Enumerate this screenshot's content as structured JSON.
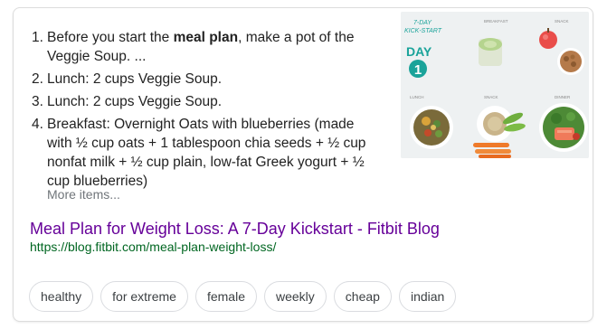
{
  "steps": [
    {
      "num": "1.",
      "pre": "Before you start the ",
      "bold": "meal plan",
      "post": ", make a pot of the Veggie Soup. ..."
    },
    {
      "num": "2.",
      "text": "Lunch: 2 cups Veggie Soup."
    },
    {
      "num": "3.",
      "text": "Lunch: 2 cups Veggie Soup."
    },
    {
      "num": "4.",
      "text": "Breakfast: Overnight Oats with blueberries (made with ½ cup oats + 1 tablespoon chia seeds + ½ cup nonfat milk + ½ cup plain, low-fat Greek yogurt + ½ cup blueberries)"
    }
  ],
  "more_items": "More items...",
  "result": {
    "title": "Meal Plan for Weight Loss: A 7-Day Kickstart - Fitbit Blog",
    "url": "https://blog.fitbit.com/meal-plan-weight-loss/"
  },
  "thumbnail": {
    "kickstart_line1": "7-DAY",
    "kickstart_line2": "KICK-START",
    "day_label": "DAY",
    "day_number": "1",
    "labels": {
      "breakfast": "BREAKFAST",
      "snack_top": "SNACK",
      "lunch": "LUNCH",
      "snack_bottom": "SNACK",
      "dinner": "DINNER"
    }
  },
  "chips": [
    "healthy",
    "for extreme",
    "female",
    "weekly",
    "cheap",
    "indian"
  ],
  "colors": {
    "link_visited": "#660099",
    "url_green": "#006621",
    "teal": "#1aa39a"
  }
}
